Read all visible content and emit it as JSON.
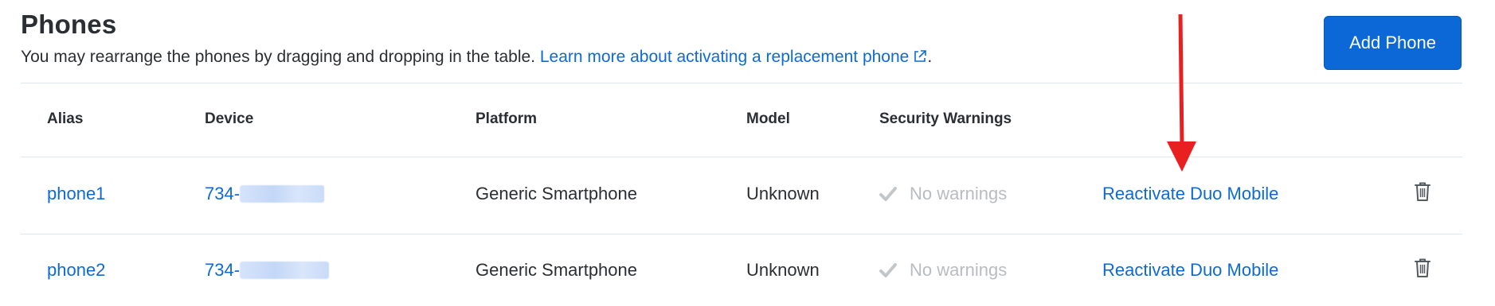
{
  "section": {
    "title": "Phones",
    "description": "You may rearrange the phones by dragging and dropping in the table.",
    "learn_more_link": "Learn more about activating a replacement phone",
    "trailing_punctuation": "."
  },
  "toolbar": {
    "add_phone_label": "Add Phone"
  },
  "table": {
    "headers": {
      "alias": "Alias",
      "device": "Device",
      "platform": "Platform",
      "model": "Model",
      "security_warnings": "Security Warnings"
    },
    "rows": [
      {
        "alias": "phone1",
        "device_prefix": "734-",
        "platform": "Generic Smartphone",
        "model": "Unknown",
        "security_warnings": "No warnings",
        "action": "Reactivate Duo Mobile"
      },
      {
        "alias": "phone2",
        "device_prefix": "734-",
        "platform": "Generic Smartphone",
        "model": "Unknown",
        "security_warnings": "No warnings",
        "action": "Reactivate Duo Mobile"
      }
    ]
  },
  "colors": {
    "link": "#0d6ad6",
    "primary_button": "#0b68d6",
    "annotation_arrow": "#e8201f",
    "muted_text": "#b9bcc0"
  },
  "icons": {
    "external_link": "external-link-icon",
    "check": "check-icon",
    "trash": "trash-icon"
  }
}
